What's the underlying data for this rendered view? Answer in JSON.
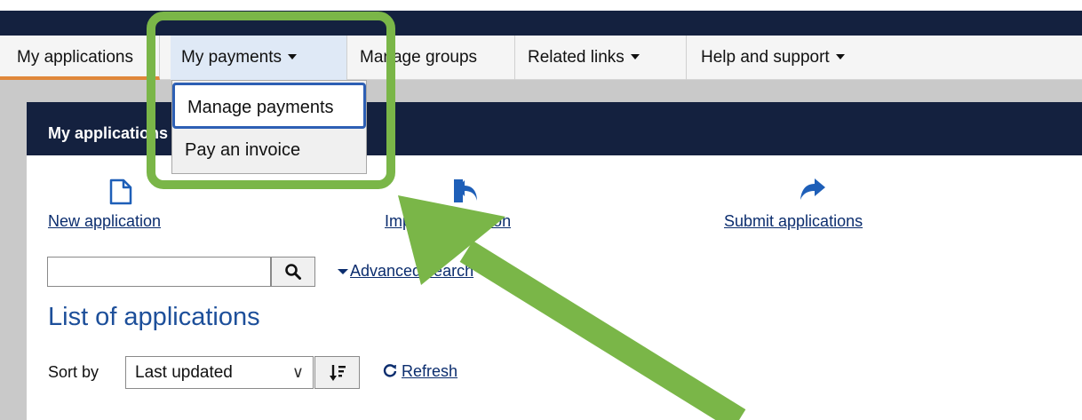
{
  "nav": {
    "items": [
      {
        "label": "My applications",
        "has_caret": false
      },
      {
        "label": "My payments",
        "has_caret": true
      },
      {
        "label": "Manage groups",
        "has_caret": false
      },
      {
        "label": "Related links",
        "has_caret": true
      },
      {
        "label": "Help and support",
        "has_caret": true
      }
    ]
  },
  "dropdown": {
    "items": [
      "Manage payments",
      "Pay an invoice"
    ]
  },
  "panel": {
    "title": "My applications"
  },
  "actions": {
    "new_application": "New application",
    "import_application": "Import application",
    "submit_applications": "Submit applications"
  },
  "search": {
    "value": "",
    "placeholder": "",
    "advanced_label": "Advanced search"
  },
  "list": {
    "title": "List of applications"
  },
  "sort": {
    "label": "Sort by",
    "selected": "Last updated"
  },
  "refresh": {
    "label": "Refresh"
  },
  "icons": {
    "new_application": "document-icon",
    "import_application": "reply-icon",
    "submit_applications": "share-forward-icon",
    "search": "search-icon",
    "sort_order": "sort-descending-icon",
    "refresh": "refresh-icon"
  },
  "colors": {
    "navy": "#14213f",
    "active_tab_underline": "#e0873a",
    "link": "#0b2d6e",
    "heading": "#1d4f9a",
    "icon_blue": "#1e5fb8",
    "annotation_green": "#7ab648",
    "dropdown_highlight_border": "#2d5fb4"
  }
}
